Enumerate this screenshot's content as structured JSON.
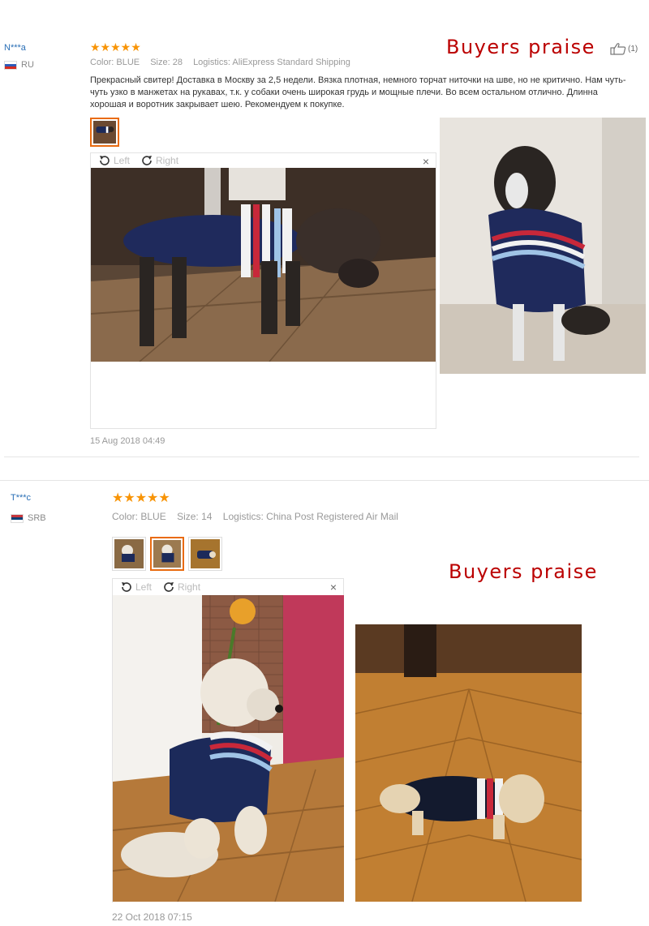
{
  "reviews": [
    {
      "user": "N***a",
      "country": "RU",
      "stars": "★★★★★",
      "color_label": "Color:",
      "color_value": "BLUE",
      "size_label": "Size:",
      "size_value": "28",
      "logistics_label": "Logistics:",
      "logistics_value": "AliExpress Standard Shipping",
      "praise": "Buyers praise",
      "helpful_count": "(1)",
      "text": "Прекрасный свитер! Доставка в Москву за 2,5 недели. Вязка плотная, немного торчат ниточки на шве, но не критично. Нам чуть-чуть узко в манжетах на рукавах, т.к. у собаки очень широкая грудь и мощные плечи. Во всем остальном отлично. Длинна хорошая и воротник закрывает шею. Рекомендуем к покупке.",
      "viewer_left": "Left",
      "viewer_right": "Right",
      "close": "×",
      "date": "15 Aug 2018 04:49"
    },
    {
      "user": "T***c",
      "country": "SRB",
      "stars": "★★★★★",
      "color_label": "Color:",
      "color_value": "BLUE",
      "size_label": "Size:",
      "size_value": "14",
      "logistics_label": "Logistics:",
      "logistics_value": "China Post Registered Air Mail",
      "praise": "Buyers praise",
      "viewer_left": "Left",
      "viewer_right": "Right",
      "close": "×",
      "date": "22 Oct 2018 07:15"
    }
  ],
  "colors": {
    "star": "#f89406",
    "praise": "#bb0000",
    "link": "#2a6fb6",
    "thumb_active": "#e96b10",
    "sweater_navy": "#1c2a5a"
  },
  "icons": [
    "like-icon",
    "rotate-left-icon",
    "rotate-right-icon",
    "close-icon",
    "flag-ru-icon",
    "flag-srb-icon"
  ]
}
